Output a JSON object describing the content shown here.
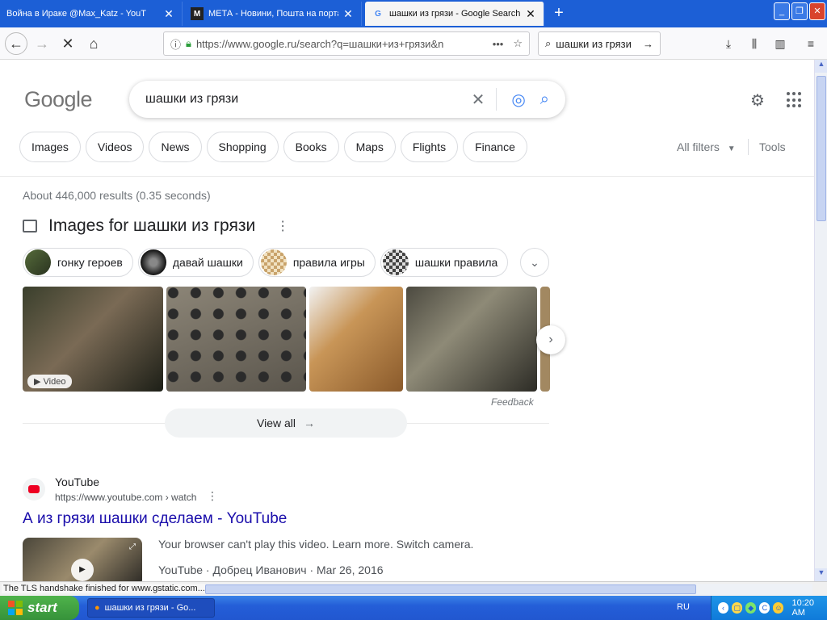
{
  "browser": {
    "tabs": [
      {
        "title": "Война в Ираке @Max_Katz - YouT",
        "favicon": "youtube-icon"
      },
      {
        "title": "МЕТА - Новини, Пошта на порта",
        "favicon": "meta-m-icon"
      },
      {
        "title": "шашки из грязи - Google Search",
        "favicon": "google-g-icon",
        "active": true
      }
    ],
    "url": "https://www.google.ru/search?q=шашки+из+грязи&n",
    "search_value": "шашки из грязи"
  },
  "google": {
    "logo": "Google",
    "query": "шашки из грязи",
    "chips": [
      "Images",
      "Videos",
      "News",
      "Shopping",
      "Books",
      "Maps",
      "Flights",
      "Finance"
    ],
    "all_filters": "All filters",
    "tools": "Tools",
    "stats": "About 446,000 results (0.35 seconds)",
    "images_header": "Images for шашки из грязи",
    "related_chips": [
      "гонку героев",
      "давай шашки",
      "правила игры",
      "шашки правила"
    ],
    "video_badge": "Video",
    "feedback": "Feedback",
    "view_all": "View all",
    "result": {
      "site": "YouTube",
      "url": "https://www.youtube.com › watch",
      "title": "А из грязи шашки сделаем - YouTube",
      "snippet": "Your browser can't play this video. Learn more. Switch camera.",
      "meta": "YouTube · Добрец Иванович · Mar 26, 2016"
    }
  },
  "status": {
    "text": "The TLS handshake finished for www.gstatic.com..."
  },
  "taskbar": {
    "start": "start",
    "task_item": "шашки из грязи - Go...",
    "lang": "RU",
    "clock": "10:20 AM"
  },
  "colors": {
    "link": "#1a0dab",
    "xp_blue": "#245ed8",
    "xp_green": "#36923a"
  }
}
